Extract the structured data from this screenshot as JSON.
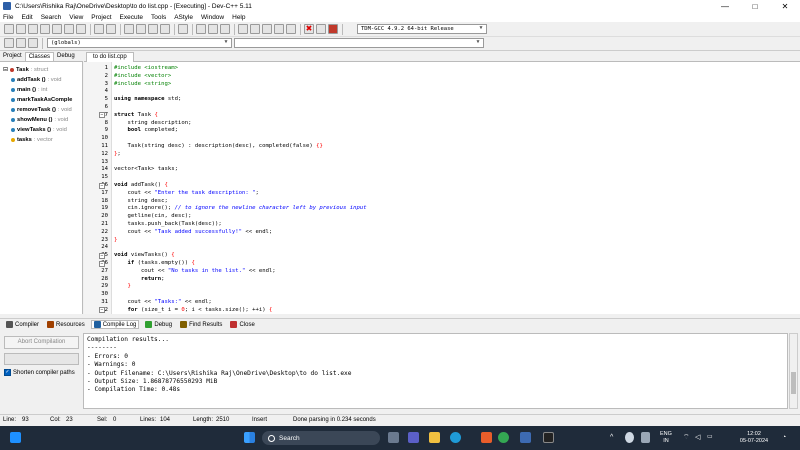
{
  "window": {
    "title": "C:\\Users\\Rishika Raj\\OneDrive\\Desktop\\to do list.cpp - [Executing] - Dev-C++ 5.11",
    "minimize": "—",
    "maximize": "□",
    "close": "✕"
  },
  "menu": [
    "File",
    "Edit",
    "Search",
    "View",
    "Project",
    "Execute",
    "Tools",
    "AStyle",
    "Window",
    "Help"
  ],
  "toolbar": {
    "compiler_select": "TDM-GCC 4.9.2 64-bit Release",
    "globals_select": "(globals)"
  },
  "left_panel": {
    "tabs": [
      "Project",
      "Classes",
      "Debug"
    ],
    "active_tab": "Classes",
    "tree": [
      {
        "name": "Task",
        "type": ": struct",
        "color": "#c0392b",
        "level": 0
      },
      {
        "name": "addTask ()",
        "type": ": void",
        "color": "#2980b9",
        "level": 1
      },
      {
        "name": "main ()",
        "type": ": int",
        "color": "#2980b9",
        "level": 1
      },
      {
        "name": "markTaskAsComple",
        "type": "",
        "color": "#2980b9",
        "level": 1
      },
      {
        "name": "removeTask ()",
        "type": ": void",
        "color": "#2980b9",
        "level": 1
      },
      {
        "name": "showMenu ()",
        "type": ": void",
        "color": "#2980b9",
        "level": 1
      },
      {
        "name": "viewTasks ()",
        "type": ": void",
        "color": "#2980b9",
        "level": 1
      },
      {
        "name": "tasks",
        "type": ": vector",
        "color": "#e6a800",
        "level": 1
      }
    ]
  },
  "editor": {
    "tab": "to do list.cpp",
    "lines": [
      {
        "n": "1",
        "t": "#include <iostream>",
        "c": "pp"
      },
      {
        "n": "2",
        "t": "#include <vector>",
        "c": "pp"
      },
      {
        "n": "3",
        "t": "#include <string>",
        "c": "pp"
      },
      {
        "n": "4",
        "t": "",
        "c": ""
      },
      {
        "n": "5",
        "t": "using namespace std;",
        "c": "kwline"
      },
      {
        "n": "6",
        "t": "",
        "c": ""
      },
      {
        "n": "7",
        "t": "struct Task {",
        "c": "kwline",
        "fold": "−"
      },
      {
        "n": "8",
        "t": "    string description;",
        "c": ""
      },
      {
        "n": "9",
        "t": "    bool completed;",
        "c": ""
      },
      {
        "n": "10",
        "t": "",
        "c": ""
      },
      {
        "n": "11",
        "t": "    Task(string desc) : description(desc), completed(false) {}",
        "c": ""
      },
      {
        "n": "12",
        "t": "};",
        "c": "sym"
      },
      {
        "n": "13",
        "t": "",
        "c": ""
      },
      {
        "n": "14",
        "t": "vector<Task> tasks;",
        "c": ""
      },
      {
        "n": "15",
        "t": "",
        "c": ""
      },
      {
        "n": "16",
        "t": "void addTask() {",
        "c": "kwline",
        "fold": "−"
      },
      {
        "n": "17",
        "t": "    cout << \"Enter the task description: \";",
        "c": "strline"
      },
      {
        "n": "18",
        "t": "    string desc;",
        "c": ""
      },
      {
        "n": "19",
        "t": "    cin.ignore(); // to ignore the newline character left by previous input",
        "c": "cmline"
      },
      {
        "n": "20",
        "t": "    getline(cin, desc);",
        "c": ""
      },
      {
        "n": "21",
        "t": "    tasks.push_back(Task(desc));",
        "c": ""
      },
      {
        "n": "22",
        "t": "    cout << \"Task added successfully!\" << endl;",
        "c": "strline"
      },
      {
        "n": "23",
        "t": "}",
        "c": "sym"
      },
      {
        "n": "24",
        "t": "",
        "c": ""
      },
      {
        "n": "25",
        "t": "void viewTasks() {",
        "c": "kwline",
        "fold": "−"
      },
      {
        "n": "26",
        "t": "    if (tasks.empty()) {",
        "c": "kwline",
        "fold": "−"
      },
      {
        "n": "27",
        "t": "        cout << \"No tasks in the list.\" << endl;",
        "c": "strline"
      },
      {
        "n": "28",
        "t": "        return;",
        "c": "kwline"
      },
      {
        "n": "29",
        "t": "    }",
        "c": "sym"
      },
      {
        "n": "30",
        "t": "",
        "c": ""
      },
      {
        "n": "31",
        "t": "    cout << \"Tasks:\" << endl;",
        "c": "strline"
      },
      {
        "n": "32",
        "t": "    for (size_t i = 0; i < tasks.size(); ++i) {",
        "c": "kwline",
        "fold": "−"
      }
    ]
  },
  "bottom_tabs": [
    {
      "label": "Compiler",
      "color": "#555"
    },
    {
      "label": "Resources",
      "color": "#a04000"
    },
    {
      "label": "Compile Log",
      "color": "#2060a0",
      "active": true
    },
    {
      "label": "Debug",
      "color": "#30a030"
    },
    {
      "label": "Find Results",
      "color": "#806000"
    },
    {
      "label": "Close",
      "color": "#c03030"
    }
  ],
  "compile_panel": {
    "abort_label": "Abort Compilation",
    "shorten_label": "Shorten compiler paths",
    "log": "Compilation results...\n--------\n- Errors: 0\n- Warnings: 0\n- Output Filename: C:\\Users\\Rishika Raj\\OneDrive\\Desktop\\to do list.exe\n- Output Size: 1.86878776550293 MiB\n- Compilation Time: 0.48s"
  },
  "status": {
    "line_label": "Line:",
    "line": "93",
    "col_label": "Col:",
    "col": "23",
    "sel_label": "Sel:",
    "sel": "0",
    "lines_label": "Lines:",
    "lines": "104",
    "length_label": "Length:",
    "length": "2510",
    "mode": "Insert",
    "message": "Done parsing in 0.234 seconds"
  },
  "taskbar": {
    "search": "Search",
    "lang1": "ENG",
    "lang2": "IN",
    "time": "12:02",
    "date": "05-07-2024"
  }
}
